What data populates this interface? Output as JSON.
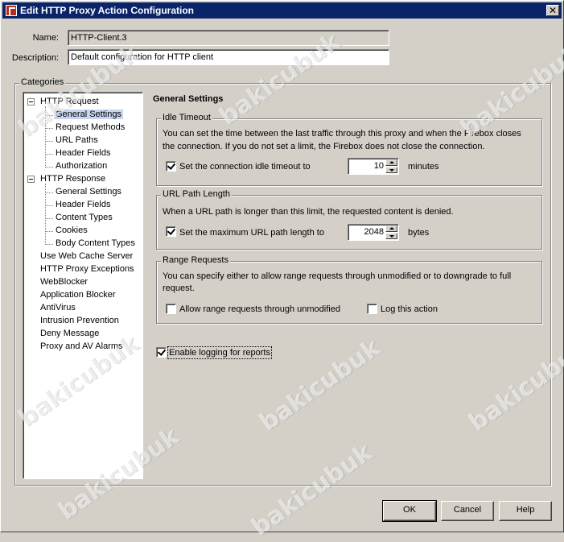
{
  "window": {
    "title": "Edit HTTP Proxy Action Configuration",
    "close_label": "✕"
  },
  "fields": {
    "name_label": "Name:",
    "name_value": "HTTP-Client.3",
    "description_label": "Description:",
    "description_value": "Default configuration for HTTP client"
  },
  "categories": {
    "title": "Categories",
    "items": [
      {
        "label": "HTTP Request",
        "level": 0,
        "expander": true
      },
      {
        "label": "General Settings",
        "level": 1,
        "selected": true
      },
      {
        "label": "Request Methods",
        "level": 1
      },
      {
        "label": "URL Paths",
        "level": 1
      },
      {
        "label": "Header Fields",
        "level": 1
      },
      {
        "label": "Authorization",
        "level": 1
      },
      {
        "label": "HTTP Response",
        "level": 0,
        "expander": true
      },
      {
        "label": "General Settings",
        "level": 1
      },
      {
        "label": "Header Fields",
        "level": 1
      },
      {
        "label": "Content Types",
        "level": 1
      },
      {
        "label": "Cookies",
        "level": 1
      },
      {
        "label": "Body Content Types",
        "level": 1
      },
      {
        "label": "Use Web Cache Server",
        "level": 0
      },
      {
        "label": "HTTP Proxy Exceptions",
        "level": 0
      },
      {
        "label": "WebBlocker",
        "level": 0
      },
      {
        "label": "Application Blocker",
        "level": 0
      },
      {
        "label": "AntiVirus",
        "level": 0
      },
      {
        "label": "Intrusion Prevention",
        "level": 0
      },
      {
        "label": "Deny Message",
        "level": 0
      },
      {
        "label": "Proxy and AV Alarms",
        "level": 0
      }
    ]
  },
  "panel": {
    "heading": "General Settings",
    "idle_timeout": {
      "title": "Idle Timeout",
      "description_line1": "You can set the time between the last traffic through this proxy and when the Firebox closes",
      "description_line2": "the connection. If you do not set a limit, the Firebox does not close the connection.",
      "checkbox_label": "Set the connection idle timeout to",
      "checked": true,
      "value": "10",
      "unit": "minutes"
    },
    "url_path_length": {
      "title": "URL Path Length",
      "description": "When a URL path is longer than this limit, the requested content is denied.",
      "checkbox_label": "Set the maximum URL path length to",
      "checked": true,
      "value": "2048",
      "unit": "bytes"
    },
    "range_requests": {
      "title": "Range Requests",
      "description_line1": "You can specify either to allow range requests through unmodified or to downgrade to full",
      "description_line2": "request.",
      "allow_label": "Allow range requests through unmodified",
      "allow_checked": false,
      "log_label": "Log this action",
      "log_checked": false
    },
    "logging": {
      "label": "Enable logging for reports",
      "checked": true
    }
  },
  "buttons": {
    "ok": "OK",
    "cancel": "Cancel",
    "help": "Help"
  },
  "watermark": "bakicubuk"
}
